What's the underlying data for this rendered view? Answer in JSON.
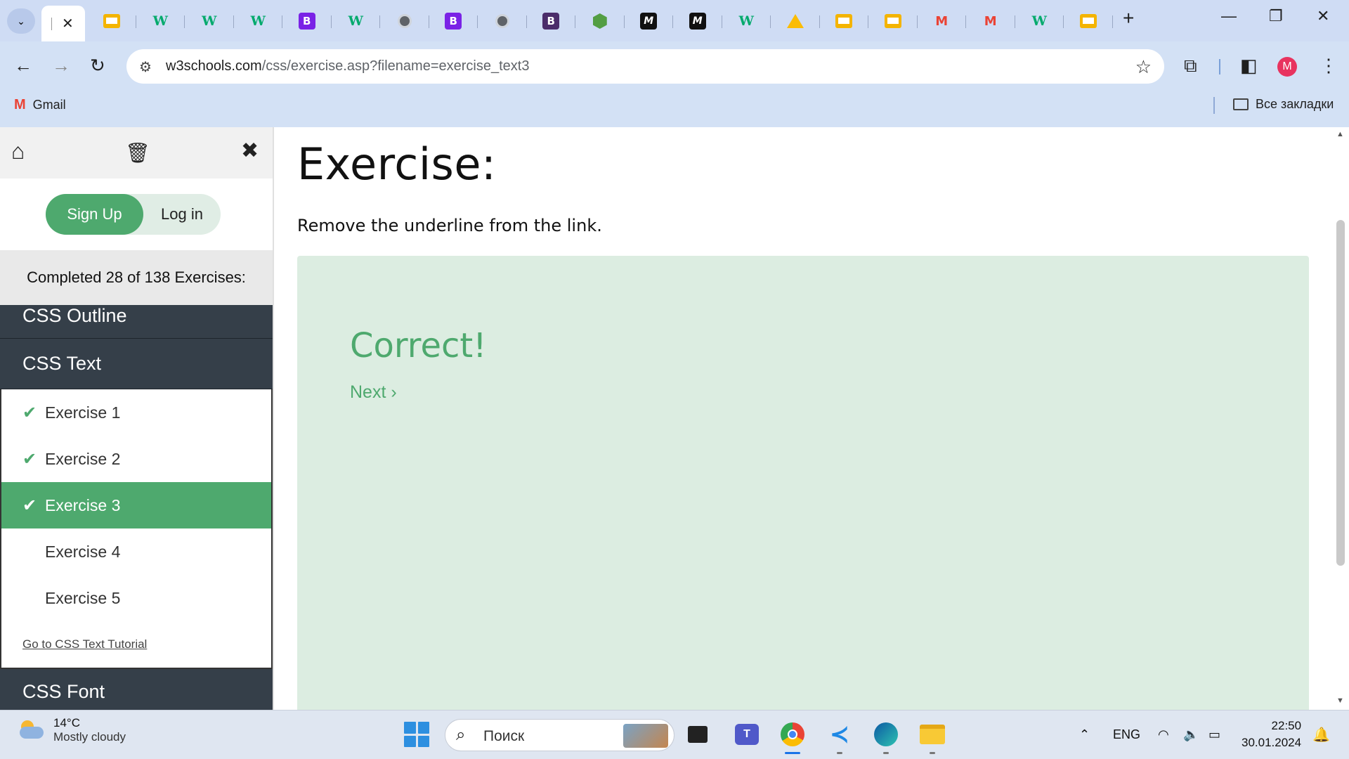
{
  "browser": {
    "tabs": [
      {
        "icon": "slides-icon"
      },
      {
        "icon": "w3schools-icon",
        "glyph": "W"
      },
      {
        "icon": "w3schools-icon",
        "glyph": "W"
      },
      {
        "icon": "w3schools-icon",
        "glyph": "W"
      },
      {
        "icon": "bootstrap-icon",
        "glyph": "B"
      },
      {
        "icon": "w3schools-icon",
        "glyph": "W"
      },
      {
        "icon": "globe-icon"
      },
      {
        "icon": "bootstrap-icon",
        "glyph": "B"
      },
      {
        "icon": "globe-icon"
      },
      {
        "icon": "bootstrap-dark-icon",
        "glyph": "B"
      },
      {
        "icon": "nodejs-icon"
      },
      {
        "icon": "mdn-icon",
        "glyph": "M"
      },
      {
        "icon": "mdn-icon",
        "glyph": "M"
      },
      {
        "icon": "w3schools-icon",
        "glyph": "W"
      },
      {
        "icon": "drive-icon"
      },
      {
        "icon": "slides-icon"
      },
      {
        "icon": "slides-icon"
      },
      {
        "icon": "gmail-icon",
        "glyph": "M"
      },
      {
        "icon": "gmail-icon",
        "glyph": "M"
      },
      {
        "icon": "w3schools-icon",
        "glyph": "W"
      },
      {
        "icon": "slides-icon"
      }
    ],
    "url_host": "w3schools.com",
    "url_path": "/css/exercise.asp?filename=exercise_text3",
    "profile_initial": "M",
    "bookmarks": {
      "gmail": "Gmail",
      "all": "Все закладки"
    }
  },
  "sidebar": {
    "signup": "Sign Up",
    "login": "Log in",
    "completed": "Completed 28 of 138 Exercises:",
    "sections": {
      "outline": "CSS Outline",
      "text": "CSS Text",
      "font": "CSS Font"
    },
    "exercises": [
      {
        "label": "Exercise 1",
        "done": true
      },
      {
        "label": "Exercise 2",
        "done": true
      },
      {
        "label": "Exercise 3",
        "done": true,
        "active": true
      },
      {
        "label": "Exercise 4",
        "done": false
      },
      {
        "label": "Exercise 5",
        "done": false
      }
    ],
    "tutorial_link": "Go to CSS Text Tutorial"
  },
  "main": {
    "title": "Exercise:",
    "description": "Remove the underline from the link.",
    "result": "Correct!",
    "next": "Next ›"
  },
  "taskbar": {
    "weather_temp": "14°C",
    "weather_desc": "Mostly cloudy",
    "search_placeholder": "Поиск",
    "lang": "ENG",
    "time": "22:50",
    "date": "30.01.2024"
  },
  "colors": {
    "accent_green": "#4ea96e",
    "sidebar_dark": "#353f49",
    "result_bg": "#dcede1"
  }
}
